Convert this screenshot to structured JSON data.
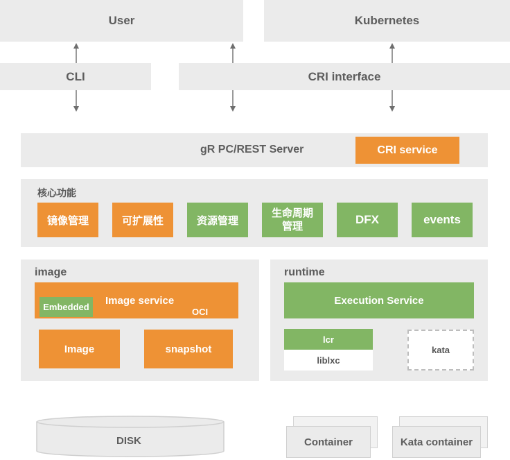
{
  "top": {
    "user": "User",
    "kubernetes": "Kubernetes"
  },
  "interfaces": {
    "cli": "CLI",
    "cri": "CRI interface"
  },
  "server": {
    "label": "gR PC/REST Server",
    "cri_service": "CRI service"
  },
  "core": {
    "title": "核心功能",
    "items": [
      {
        "lines": [
          "镜像管理"
        ]
      },
      {
        "lines": [
          "可扩展性"
        ]
      },
      {
        "lines": [
          "资源管理"
        ]
      },
      {
        "lines": [
          "生命周期",
          "管理"
        ]
      },
      {
        "lines": [
          "DFX"
        ]
      },
      {
        "lines": [
          "events"
        ]
      }
    ]
  },
  "image": {
    "title": "image",
    "service": "Image service",
    "embedded": "Embedded",
    "oci": "OCI",
    "image": "Image",
    "snapshot": "snapshot"
  },
  "runtime": {
    "title": "runtime",
    "execution": "Execution Service",
    "lcr": "lcr",
    "liblxc": "liblxc",
    "kata": "kata"
  },
  "bottom": {
    "disk": "DISK",
    "container": "Container",
    "kata_container": "Kata container"
  },
  "colors": {
    "orange": "#ee9235",
    "green": "#82b664",
    "gray": "#ebebeb",
    "text": "#5d5d5d"
  }
}
